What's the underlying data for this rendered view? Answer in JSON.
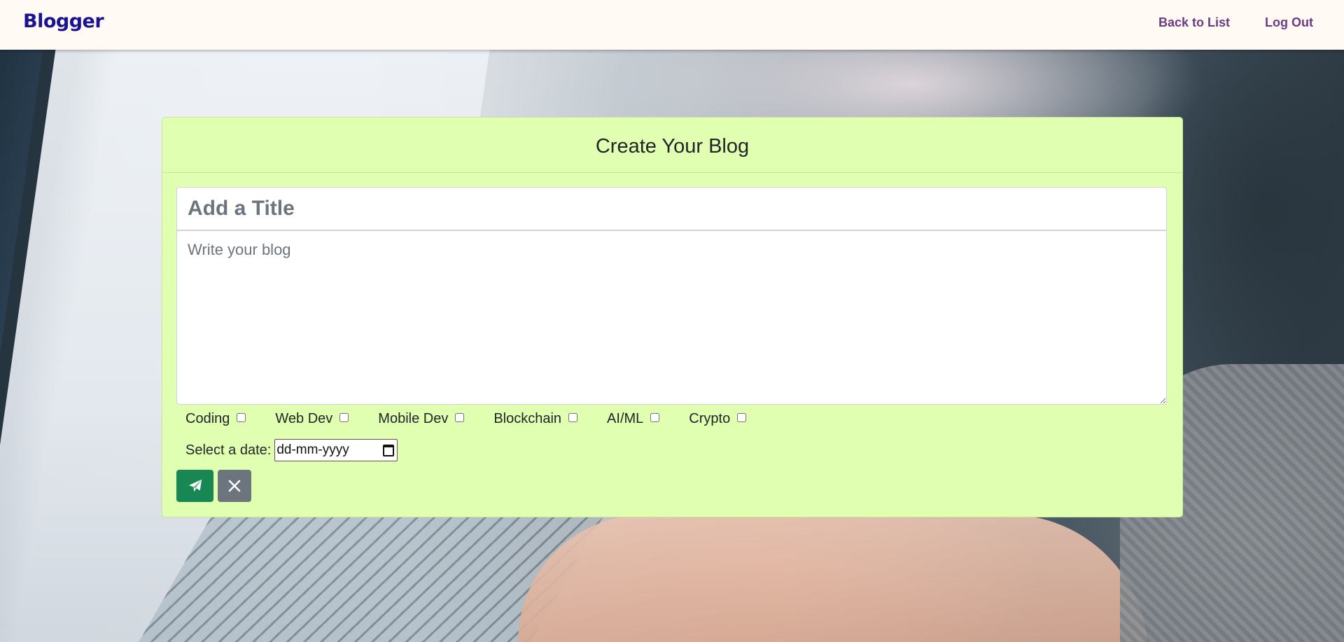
{
  "navbar": {
    "brand": "Blogger",
    "links": [
      {
        "label": "Back to List"
      },
      {
        "label": "Log Out"
      }
    ]
  },
  "form": {
    "heading": "Create Your Blog",
    "title_placeholder": "Add a Title",
    "title_value": "",
    "body_placeholder": "Write your blog",
    "body_value": "",
    "tags": [
      {
        "label": "Coding",
        "checked": false
      },
      {
        "label": "Web Dev",
        "checked": false
      },
      {
        "label": "Mobile Dev",
        "checked": false
      },
      {
        "label": "Blockchain",
        "checked": false
      },
      {
        "label": "AI/ML",
        "checked": false
      },
      {
        "label": "Crypto",
        "checked": false
      }
    ],
    "date_label": "Select a date:",
    "date_placeholder": "dd-mm-yyyy",
    "date_icon": "calendar-icon",
    "submit_icon": "paper-plane-icon",
    "cancel_icon": "close-icon"
  },
  "colors": {
    "brand": "#1a1493",
    "nav_link": "#6b3b86",
    "card_bg": "#e0ffb0",
    "submit_button": "#198754",
    "cancel_button": "#6c757d"
  }
}
